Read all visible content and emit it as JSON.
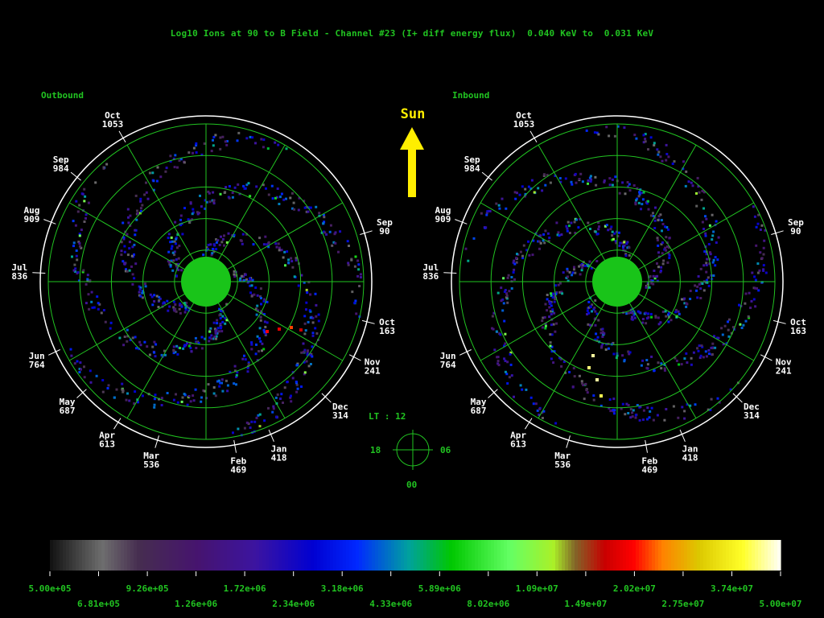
{
  "title": "Log10 Ions at 90 to B Field - Channel #23 (I+ diff energy flux)  0.040 KeV to  0.031 KeV",
  "panels": [
    {
      "label": "Outbound"
    },
    {
      "label": "Inbound"
    }
  ],
  "sun_label": "Sun",
  "month_ticks": [
    {
      "month": "Oct",
      "day": "1053"
    },
    {
      "month": "Sep",
      "day": "984"
    },
    {
      "month": "Aug",
      "day": "909"
    },
    {
      "month": "Jul",
      "day": "836"
    },
    {
      "month": "Jun",
      "day": "764"
    },
    {
      "month": "May",
      "day": "687"
    },
    {
      "month": "Apr",
      "day": "613"
    },
    {
      "month": "Mar",
      "day": "536"
    },
    {
      "month": "Feb",
      "day": "469"
    },
    {
      "month": "Jan",
      "day": "418"
    },
    {
      "month": "Dec",
      "day": "314"
    },
    {
      "month": "Nov",
      "day": "241"
    },
    {
      "month": "Oct",
      "day": "163"
    },
    {
      "month": "Sep",
      "day": "90"
    }
  ],
  "local_time": {
    "title": "LT : 12",
    "left": "18",
    "right": "06",
    "bottom": "00"
  },
  "colorbar": {
    "ticks_top": [
      "5.00e+05",
      "9.26e+05",
      "1.72e+06",
      "3.18e+06",
      "5.89e+06",
      "1.09e+07",
      "2.02e+07",
      "3.74e+07"
    ],
    "ticks_bottom": [
      "6.81e+05",
      "1.26e+06",
      "2.34e+06",
      "4.33e+06",
      "8.02e+06",
      "1.49e+07",
      "2.75e+07",
      "5.00e+07"
    ]
  },
  "chart_data": {
    "type": "heatmap",
    "projection": "polar",
    "scale": "log10",
    "range": [
      500000,
      50000000
    ],
    "grid": true,
    "colors": {
      "grid": "#21c321",
      "text": "#21c321",
      "label": "#ffffff",
      "sun_arrow": "#ffee00",
      "planet": "#19c419"
    }
  }
}
